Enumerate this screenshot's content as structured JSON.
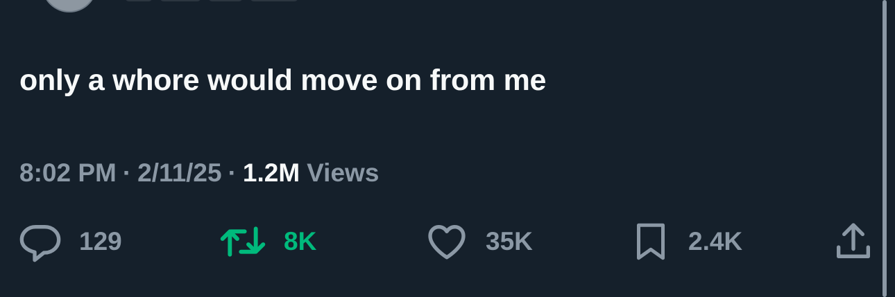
{
  "tweet": {
    "text": "only a whore would move on from me"
  },
  "meta": {
    "time": "8:02 PM",
    "separator": "·",
    "date": "2/11/25",
    "views_count": "1.2M",
    "views_label": "Views"
  },
  "actions": {
    "reply_count": "129",
    "retweet_count": "8K",
    "like_count": "35K",
    "bookmark_count": "2.4K"
  },
  "colors": {
    "background": "#15202b",
    "text_primary": "#f7f9f9",
    "text_secondary": "#8b98a5",
    "retweet_active": "#00ba7c"
  },
  "icons": [
    "reply-icon",
    "retweet-icon",
    "like-icon",
    "bookmark-icon",
    "share-icon"
  ]
}
